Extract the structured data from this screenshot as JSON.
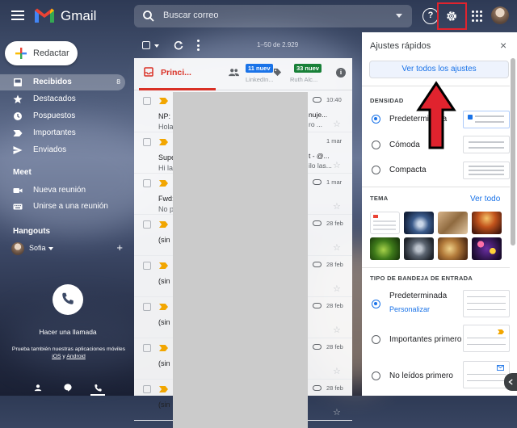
{
  "app": {
    "brand": "Gmail"
  },
  "search": {
    "placeholder": "Buscar correo"
  },
  "help_glyph": "?",
  "sidebar": {
    "compose_label": "Redactar",
    "items": [
      {
        "label": "Recibidos",
        "count": "8",
        "icon": "inbox-icon",
        "active": true
      },
      {
        "label": "Destacados",
        "icon": "star-icon"
      },
      {
        "label": "Pospuestos",
        "icon": "clock-icon"
      },
      {
        "label": "Importantes",
        "icon": "label-important-icon"
      },
      {
        "label": "Enviados",
        "icon": "send-icon"
      }
    ],
    "meet_title": "Meet",
    "meet_items": [
      {
        "label": "Nueva reunión",
        "icon": "video-icon"
      },
      {
        "label": "Unirse a una reunión",
        "icon": "keyboard-icon"
      }
    ],
    "hangouts_title": "Hangouts",
    "hangouts_user": "Sofia",
    "hangouts_add": "+",
    "call_label": "Hacer una llamada",
    "promo_text": "Prueba también nuestras aplicaciones móviles",
    "promo_ios": "iOS",
    "promo_and": " y ",
    "promo_android": "Android"
  },
  "toolbar": {
    "pager": "1–50 de 2.929"
  },
  "tabs": [
    {
      "label": "Princi...",
      "color": "#d93025"
    },
    {
      "badge": "11 nuev",
      "badge_color": "#1a73e8",
      "sub": "LinkedIn..."
    },
    {
      "badge": "33 nuev",
      "badge_color": "#188038",
      "sub": "Ruth Alc..."
    }
  ],
  "emails": [
    {
      "sender": "NP:",
      "snippet": "Hola",
      "subject": "nuje...",
      "snippet2": "ro ...",
      "date": "10:40",
      "clip": true
    },
    {
      "sender": "Supe",
      "snippet": "Hi las...",
      "subject": "t - @...",
      "snippet2": "ilo las...",
      "date": "1 mar",
      "clip": false
    },
    {
      "sender": "Fwd:",
      "snippet": "No p",
      "subject": "",
      "snippet2": "",
      "date": "1 mar",
      "clip": true
    },
    {
      "sender": "(sin",
      "snippet": "",
      "subject": "",
      "snippet2": "",
      "date": "28 feb",
      "clip": true
    },
    {
      "sender": "(sin",
      "snippet": "",
      "subject": "",
      "snippet2": "",
      "date": "28 feb",
      "clip": true
    },
    {
      "sender": "(sin",
      "snippet": "",
      "subject": "",
      "snippet2": "",
      "date": "28 feb",
      "clip": true
    },
    {
      "sender": "(sin",
      "snippet": "",
      "subject": "",
      "snippet2": "",
      "date": "28 feb",
      "clip": true
    },
    {
      "sender": "(sin",
      "snippet": "",
      "subject": "",
      "snippet2": "",
      "date": "28 feb",
      "clip": true
    }
  ],
  "quick_settings": {
    "title": "Ajustes rápidos",
    "close_glyph": "×",
    "see_all_settings": "Ver todos los ajustes",
    "density_title": "DENSIDAD",
    "density_options": [
      "Predeterminada",
      "Cómoda",
      "Compacta"
    ],
    "density_selected": 0,
    "theme_title": "TEMA",
    "theme_see_all": "Ver todo",
    "inbox_title": "TIPO DE BANDEJA DE ENTRADA",
    "inbox_options": [
      "Predeterminada",
      "Importantes primero",
      "No leídos primero"
    ],
    "inbox_customize": "Personalizar",
    "inbox_selected": 0
  },
  "colors": {
    "highlight": "#e0232e",
    "arrow": "#e0232e",
    "accent": "#1a73e8"
  }
}
